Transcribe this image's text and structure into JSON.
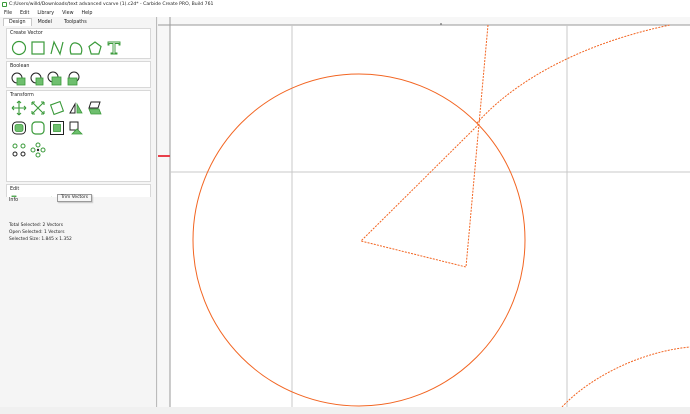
{
  "window": {
    "title": "C:/Users/willd/Downloads/text advanced vcarve (1).c2d* - Carbide Create PRO, Build 761"
  },
  "menu": {
    "items": [
      {
        "label": "File"
      },
      {
        "label": "Edit"
      },
      {
        "label": "Library"
      },
      {
        "label": "View"
      },
      {
        "label": "Help"
      }
    ]
  },
  "tabs": [
    {
      "label": "Design",
      "active": true
    },
    {
      "label": "Model",
      "active": false
    },
    {
      "label": "Toolpaths",
      "active": false
    }
  ],
  "sections": {
    "create_vector": {
      "title": "Create Vector",
      "icons": [
        "circle-icon",
        "rectangle-icon",
        "polyline-icon",
        "curve-icon",
        "polygon-icon",
        "text-icon"
      ]
    },
    "boolean": {
      "title": "Boolean",
      "icons": [
        "union-icon",
        "subtract-icon",
        "intersect-icon",
        "weld-icon"
      ]
    },
    "transform": {
      "title": "Transform",
      "icons": [
        "move-icon",
        "scale-icon",
        "rotate-icon",
        "mirror-icon",
        "skew-icon",
        "offset-icon",
        "fillet-icon",
        "align-icon",
        "array-icon",
        "circular-array-icon",
        "pattern-icon"
      ]
    },
    "edit": {
      "title": "Edit",
      "icons": [
        "node-edit-icon",
        "join-icon",
        "trim-icon",
        "trim-vectors-icon"
      ]
    },
    "info": {
      "title": "Info",
      "total_selected": "Total Selected:  2 Vectors",
      "open_selected": "Open Selected:  1 Vectors",
      "selected_size": "Selected Size:   1.845 x 1.352"
    }
  },
  "tooltip": {
    "label": "Trim Vectors"
  },
  "colors": {
    "icon_green": "#3a9a3a",
    "vector_orange": "#f26522",
    "grid_gray": "#c8c8c8",
    "ruler_red": "#e8404a"
  }
}
